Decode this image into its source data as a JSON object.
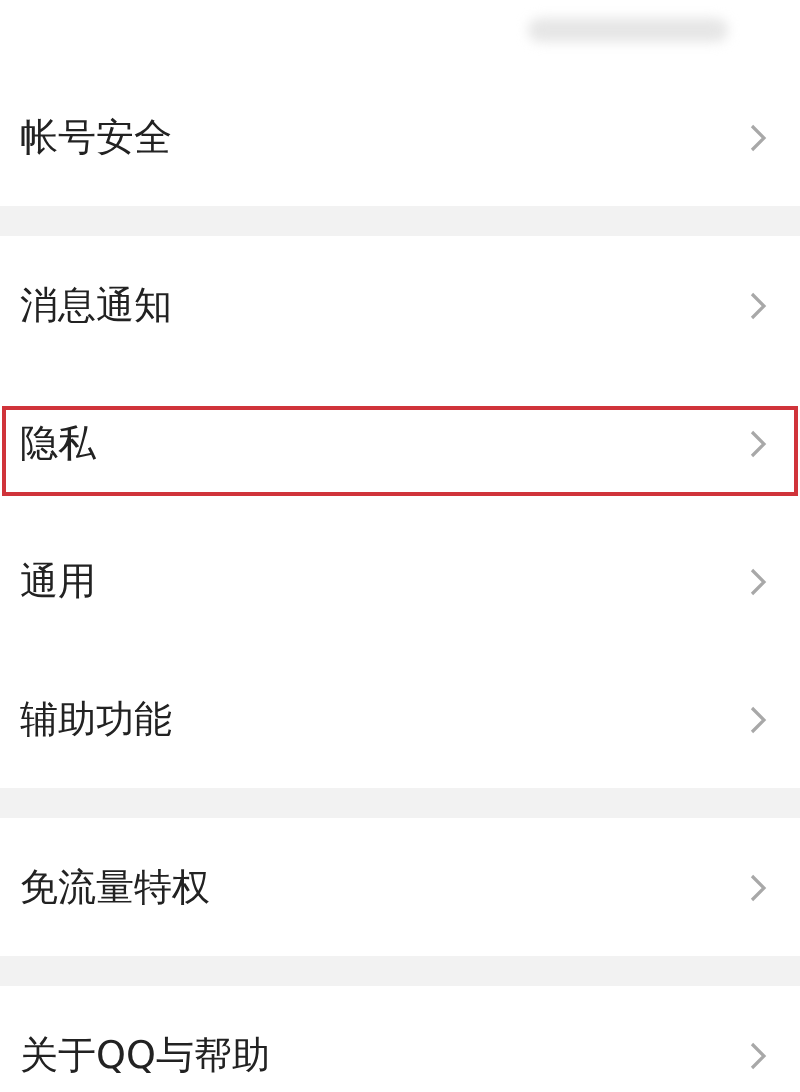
{
  "groups": [
    {
      "items": [
        {
          "kind": "redacted",
          "highlighted": false
        },
        {
          "kind": "link",
          "label": "帐号安全",
          "highlighted": false
        }
      ]
    },
    {
      "items": [
        {
          "kind": "link",
          "label": "消息通知",
          "highlighted": false
        },
        {
          "kind": "link",
          "label": "隐私",
          "highlighted": true
        },
        {
          "kind": "link",
          "label": "通用",
          "highlighted": false
        },
        {
          "kind": "link",
          "label": "辅助功能",
          "highlighted": false
        }
      ]
    },
    {
      "items": [
        {
          "kind": "link",
          "label": "免流量特权",
          "highlighted": false
        }
      ]
    },
    {
      "items": [
        {
          "kind": "link",
          "label": "关于QQ与帮助",
          "highlighted": false
        }
      ]
    }
  ]
}
